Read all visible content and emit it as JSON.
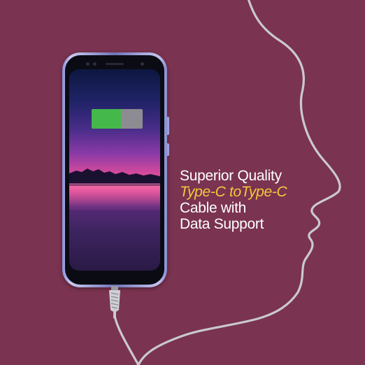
{
  "headline": {
    "line1": "Superior Quality",
    "line2": "Type-C toType-C",
    "line3": "Cable with",
    "line4": "Data Support"
  },
  "colors": {
    "background": "#7a3350",
    "accent_text": "#f6c73d",
    "battery_charge": "#44b84a",
    "battery_empty": "#8c8c92",
    "cable": "#c9c9cf"
  },
  "battery": {
    "charge_fraction": 0.58
  },
  "icons": [
    "battery-icon",
    "face-profile-cable-outline"
  ]
}
